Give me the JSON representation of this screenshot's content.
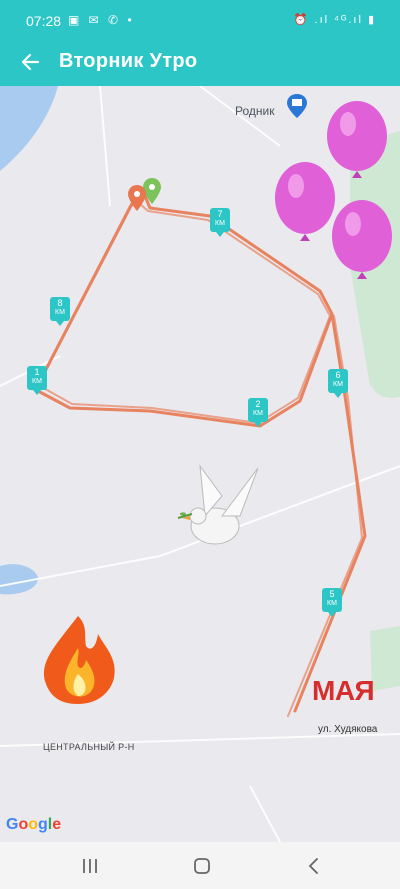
{
  "status_bar": {
    "time": "07:28",
    "left_icons": "▣ ✉ ✆ •",
    "right_icons": "⏰ .ıl ⁴ᴳ.ıl ▮"
  },
  "app_bar": {
    "title": "Вторник Утро",
    "background": "#2dc6c6"
  },
  "map": {
    "poi": "Родник",
    "road": "ул. Худякова",
    "district": "ЦЕНТРАЛЬНЫЙ Р-Н",
    "route_color": "#e8764e",
    "km_unit": "КМ",
    "km_markers": [
      {
        "num": "1"
      },
      {
        "num": "2"
      },
      {
        "num": "5"
      },
      {
        "num": "6"
      },
      {
        "num": "7"
      },
      {
        "num": "8"
      }
    ],
    "overlay_text": "МАЯ",
    "google": [
      "G",
      "o",
      "o",
      "g",
      "l",
      "e"
    ]
  },
  "nav": {
    "recent_icon": "recent-apps-icon",
    "home_icon": "home-icon",
    "back_icon": "back-icon"
  }
}
